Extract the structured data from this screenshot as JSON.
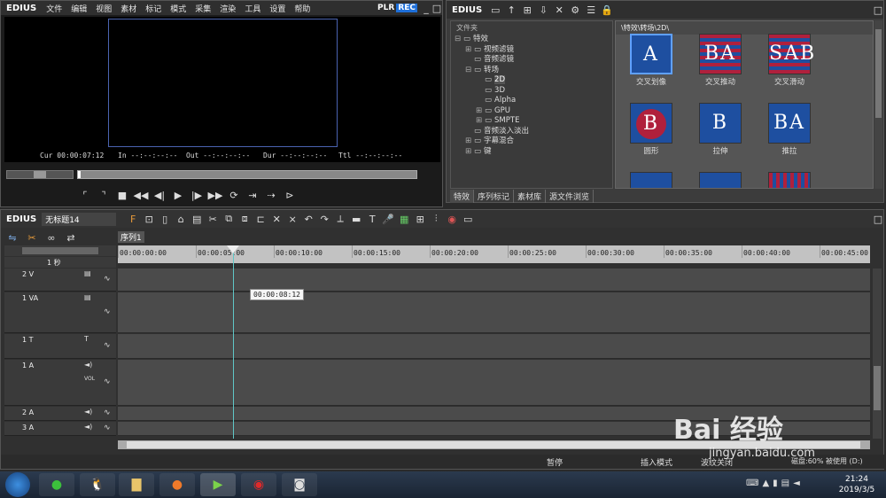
{
  "player": {
    "logo": "EDIUS",
    "menu": [
      "文件",
      "编辑",
      "视图",
      "素材",
      "标记",
      "模式",
      "采集",
      "渲染",
      "工具",
      "设置",
      "帮助"
    ],
    "plr": "PLR",
    "rec": "REC",
    "cur_label": "Cur",
    "cur_value": "00:00:07:12",
    "in_label": "In",
    "in_value": "--:--:--:--",
    "out_label": "Out",
    "out_value": "--:--:--:--",
    "dur_label": "Dur",
    "dur_value": "--:--:--:--",
    "ttl_label": "Ttl",
    "ttl_value": "--:--:--:--"
  },
  "effects": {
    "logo": "EDIUS",
    "folder_header": "文件夹",
    "path": "\\特效\\转场\\2D\\",
    "tree": [
      {
        "label": "特效",
        "indent": 0,
        "sign": "⊟"
      },
      {
        "label": "视频滤镜",
        "indent": 1,
        "sign": "⊞"
      },
      {
        "label": "音频滤镜",
        "indent": 1,
        "sign": ""
      },
      {
        "label": "转场",
        "indent": 1,
        "sign": "⊟"
      },
      {
        "label": "2D",
        "indent": 2,
        "sign": ""
      },
      {
        "label": "3D",
        "indent": 2,
        "sign": ""
      },
      {
        "label": "Alpha",
        "indent": 2,
        "sign": ""
      },
      {
        "label": "GPU",
        "indent": 2,
        "sign": "⊞"
      },
      {
        "label": "SMPTE",
        "indent": 2,
        "sign": "⊞"
      },
      {
        "label": "音频淡入淡出",
        "indent": 1,
        "sign": ""
      },
      {
        "label": "字幕混合",
        "indent": 1,
        "sign": "⊞"
      },
      {
        "label": "键",
        "indent": 1,
        "sign": "⊞"
      }
    ],
    "thumbnails": [
      {
        "label": "交叉划像",
        "letters": "A"
      },
      {
        "label": "交叉推动",
        "letters": "BA"
      },
      {
        "label": "交叉滑动",
        "letters": "SAB"
      },
      {
        "label": "圆形",
        "letters": "B"
      },
      {
        "label": "拉伸",
        "letters": "B"
      },
      {
        "label": "推拉",
        "letters": "BA"
      }
    ],
    "tabs": [
      "特效",
      "序列标记",
      "素材库",
      "源文件浏览"
    ]
  },
  "timeline": {
    "logo": "EDIUS",
    "project": "无标题14",
    "sequence_tab": "序列1",
    "scale": "1 秒",
    "ruler": [
      "00:00:00:00",
      "00:00:05:00",
      "00:00:10:00",
      "00:00:15:00",
      "00:00:20:00",
      "00:00:25:00",
      "00:00:30:00",
      "00:00:35:00",
      "00:00:40:00",
      "00:00:45:00"
    ],
    "tooltip": "00:00:08:12",
    "tracks": [
      {
        "name": "2 V",
        "kind": "video"
      },
      {
        "name": "1 VA",
        "kind": "va"
      },
      {
        "name": "1 T",
        "kind": "title"
      },
      {
        "name": "1 A",
        "kind": "audio"
      },
      {
        "name": "2 A",
        "kind": "audio"
      },
      {
        "name": "3 A",
        "kind": "audio"
      }
    ],
    "vol": "VOL",
    "status_pause": "暂停",
    "status_insert": "插入模式",
    "status_ripple": "波纹关闭",
    "status_disk": "磁盘:60% 被使用 (D:)"
  },
  "taskbar": {
    "time": "21:24",
    "date": "2019/3/5"
  },
  "watermark": {
    "text": "Bai 经验",
    "url": "jingyan.baidu.com"
  },
  "colors": {
    "rec_bg": "#1e6fd9",
    "playhead": "#5fc7c7",
    "thumb_blue": "#1e4fa0",
    "thumb_red": "#b0203c"
  }
}
